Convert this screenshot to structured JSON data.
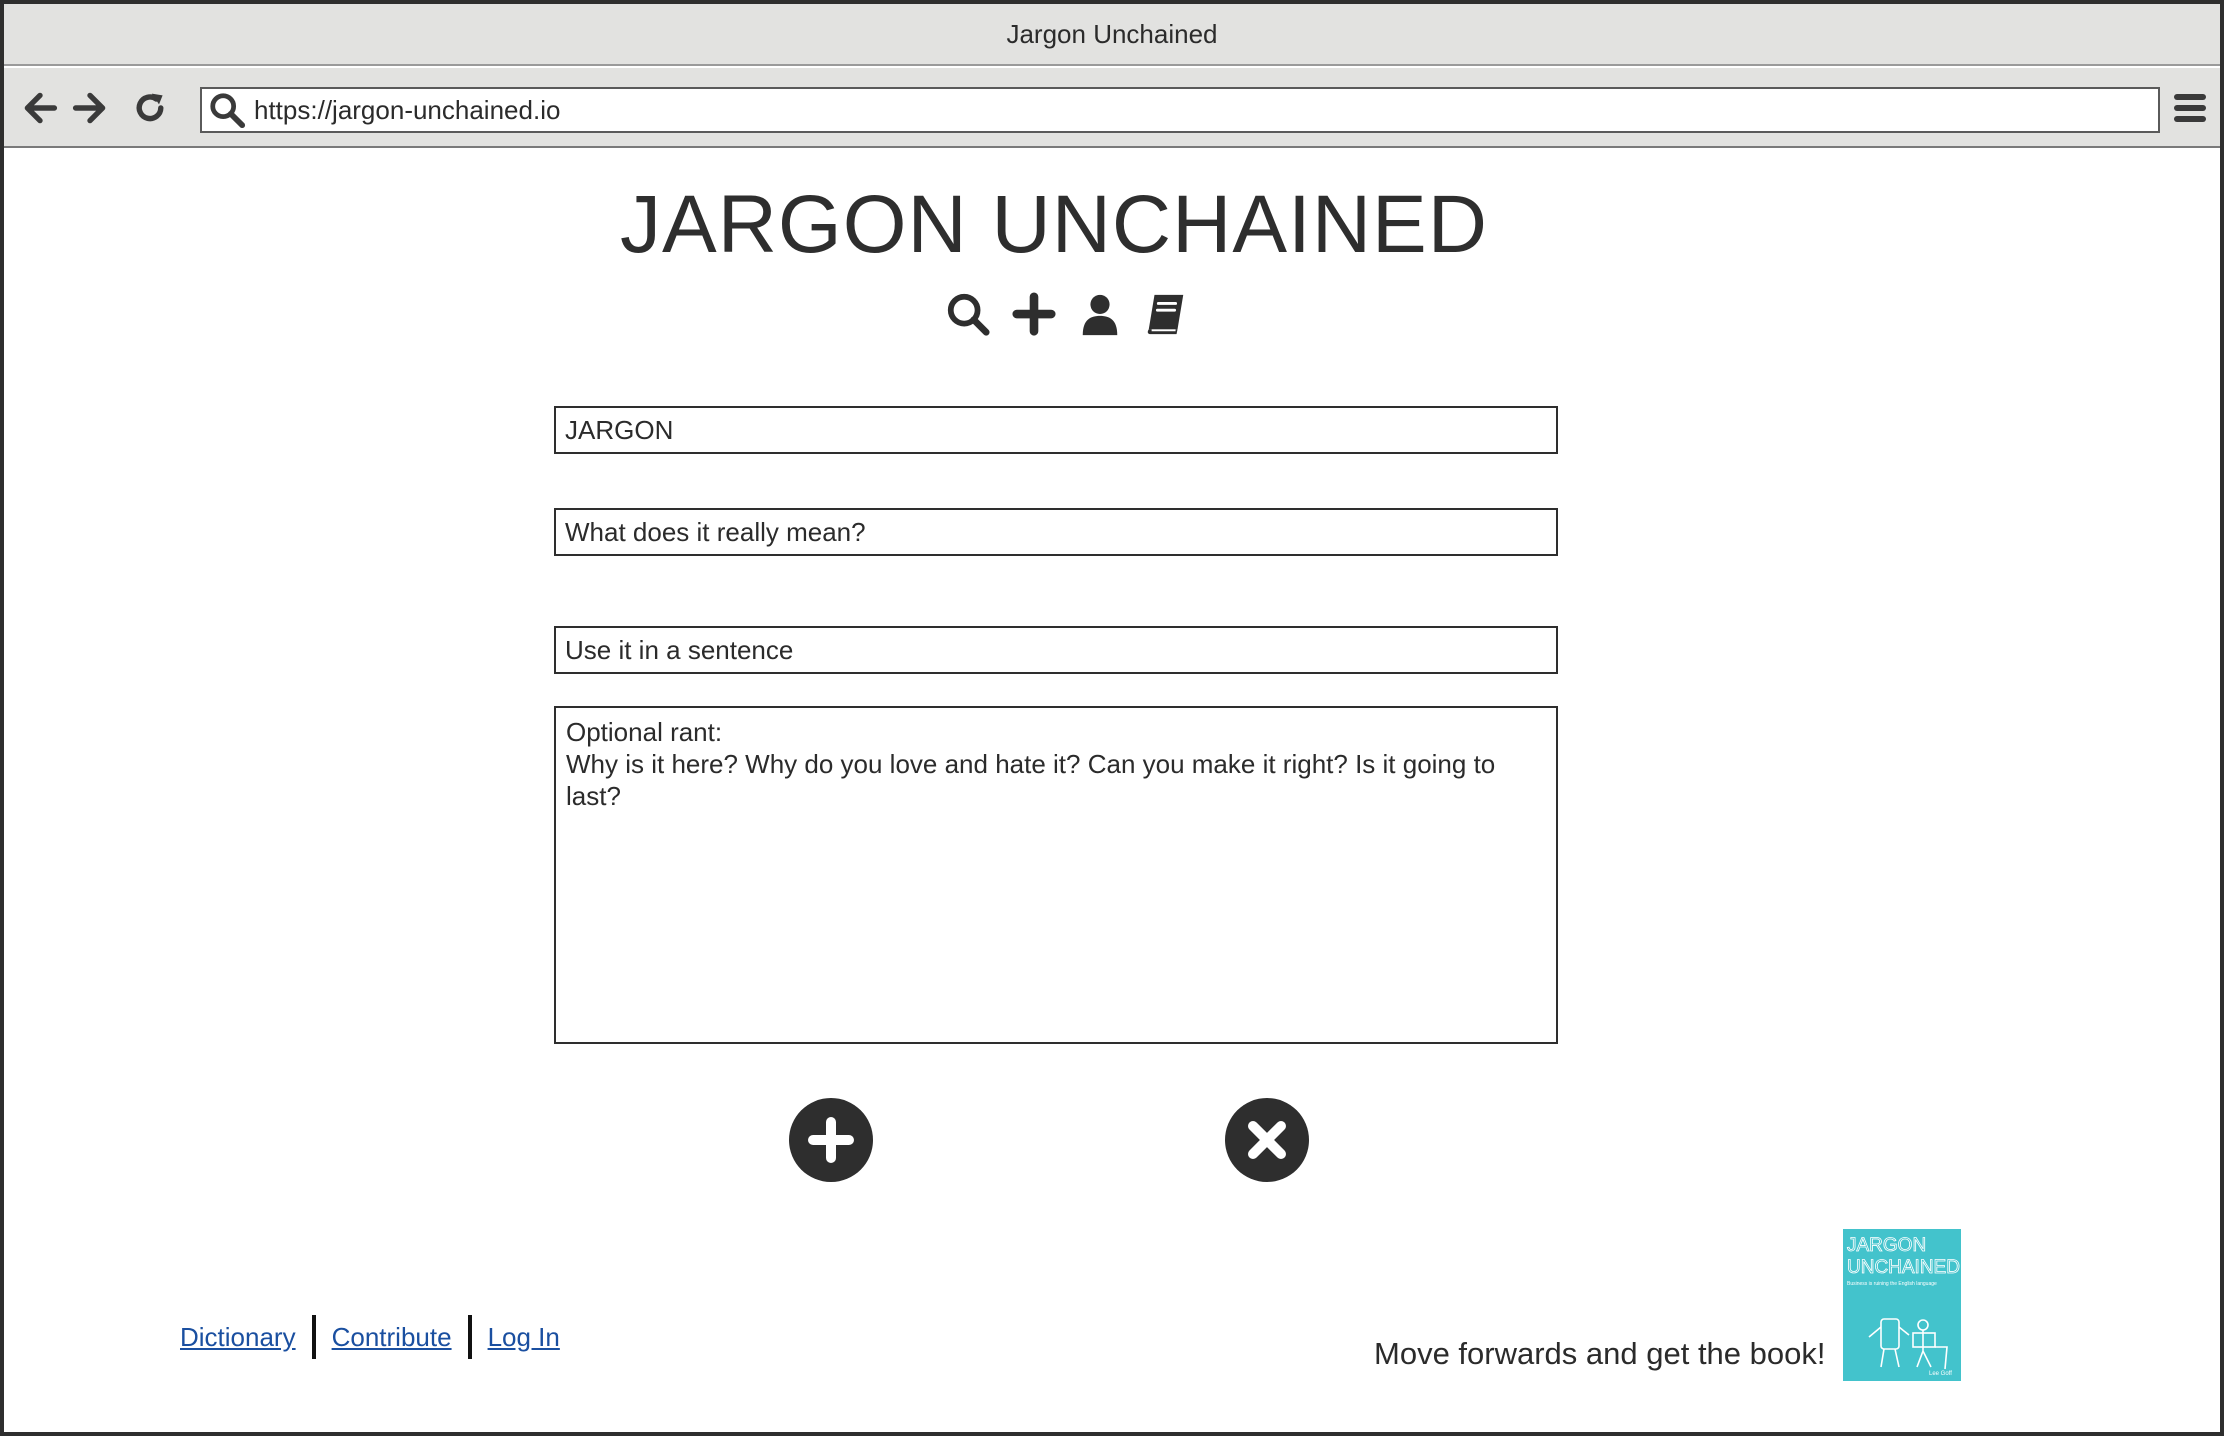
{
  "window": {
    "title": "Jargon Unchained"
  },
  "browser": {
    "url": "https://jargon-unchained.io",
    "back_icon": "arrow-left-icon",
    "forward_icon": "arrow-right-icon",
    "reload_icon": "reload-icon",
    "menu_icon": "hamburger-menu-icon"
  },
  "header": {
    "title": "JARGON UNCHAINED",
    "nav_icons": [
      "search-icon",
      "plus-icon",
      "user-icon",
      "book-icon"
    ]
  },
  "form": {
    "jargon_placeholder": "JARGON",
    "meaning_placeholder": "What does it really mean?",
    "sentence_placeholder": "Use it in a sentence",
    "rant_placeholder": "Optional rant:\nWhy is it here? Why do you love and hate it? Can you make it right? Is it going to last?",
    "submit_icon": "plus-circle-icon",
    "cancel_icon": "x-circle-icon"
  },
  "footer": {
    "links": [
      "Dictionary",
      "Contribute",
      "Log In"
    ],
    "promo_text": "Move forwards and get the book!",
    "book_cover": {
      "title_line1": "JARGON",
      "title_line2": "UNCHAINED",
      "subtitle": "Business is ruining the English language",
      "author": "Lee Goff"
    }
  },
  "colors": {
    "chrome": "#e2e2e0",
    "dark": "#2e2e2e",
    "link": "#1a4fa0",
    "book": "#43c3cc"
  }
}
